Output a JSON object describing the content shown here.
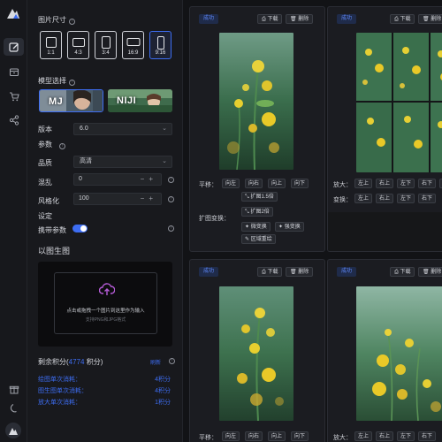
{
  "sidebar_rail": {
    "items": [
      {
        "icon": "edit-image-icon",
        "active": true
      },
      {
        "icon": "box-icon",
        "active": false
      },
      {
        "icon": "cart-icon",
        "active": false
      },
      {
        "icon": "share-icon",
        "active": false
      }
    ],
    "bottom": [
      {
        "icon": "gift-icon"
      },
      {
        "icon": "moon-icon"
      },
      {
        "icon": "avatar-icon"
      }
    ]
  },
  "settings": {
    "size_label": "图片尺寸",
    "ratios": [
      "1:1",
      "4:3",
      "3:4",
      "16:9",
      "9:16"
    ],
    "selected_ratio": "9:16",
    "model_label": "模型选择",
    "models": [
      "MJ",
      "NIJI"
    ],
    "selected_model": "MJ",
    "version_label": "版本",
    "version_value": "6.0",
    "params_label": "参数",
    "quality_label": "品质",
    "quality_value": "高清",
    "chaos_label": "混乱",
    "chaos_value": "0",
    "stylize_label": "风格化",
    "stylize_value": "100",
    "settings_label": "设定",
    "carry_params_label": "携带参数",
    "carry_params_on": true,
    "img2img_label": "以图生图",
    "upload_text": "点击或拖拽一个图片到这里作为输入",
    "upload_hint": "支持PNG和JPG格式",
    "credits_label_prefix": "剩余积分(",
    "credits_value": "4774",
    "credits_label_suffix": " 积分)",
    "refresh_label": "刷新",
    "costs": [
      {
        "label": "绘图单次消耗：",
        "value": "4积分"
      },
      {
        "label": "图生图单次消耗：",
        "value": "4积分"
      },
      {
        "label": "放大单次消耗：",
        "value": "1积分"
      }
    ]
  },
  "cards": [
    {
      "status": "成功",
      "download": "下载",
      "delete": "删除",
      "pan_label": "平移：",
      "pan_buttons": [
        "向左",
        "向右",
        "向上",
        "向下"
      ],
      "zoom_button_1": "扩图1.5倍",
      "zoom_label": "扩图变换：",
      "zoom_button_2": "扩图2倍",
      "vary_subtle": "微变换",
      "vary_strong": "强变换",
      "region_redraw": "区域重绘"
    },
    {
      "status": "成功",
      "download": "下载",
      "delete": "删除",
      "upscale_label": "放大：",
      "upscale_buttons": [
        "左上",
        "右上",
        "左下",
        "右下"
      ],
      "vary_label": "变换：",
      "vary_buttons": [
        "左上",
        "右上",
        "左下",
        "右下"
      ]
    },
    {
      "status": "成功",
      "download": "下载",
      "delete": "删除",
      "pan_label": "平移：",
      "pan_buttons": [
        "向左",
        "向右",
        "向上",
        "向下"
      ]
    },
    {
      "status": "成功",
      "download": "下载",
      "delete": "删除",
      "upscale_label": "放大：",
      "upscale_buttons": [
        "左上",
        "右上",
        "左下",
        "右下"
      ]
    }
  ],
  "colors": {
    "accent": "#3d6df2",
    "background": "#121316",
    "panel": "#18191d",
    "card": "#1b1c21",
    "flower_yellow": "#e9c928",
    "foliage_green": "#2f6b3e"
  }
}
